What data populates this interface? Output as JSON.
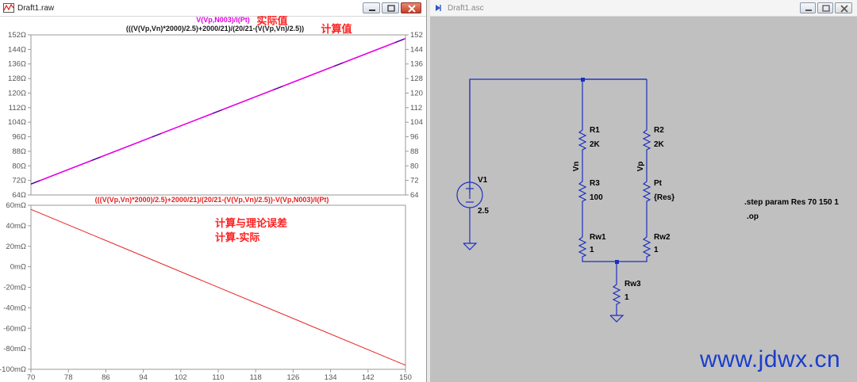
{
  "waveform_window": {
    "title": "Draft1.raw",
    "top_pane": {
      "trace_label_measured": "V(Vp,N003)/I(Pt)",
      "annotation_measured": "实际值",
      "trace_label_calc": "(((V(Vp,Vn)*2000)/2.5)+2000/21)/(20/21-(V(Vp,Vn)/2.5))",
      "annotation_calc": "计算值",
      "y_ticks_left": [
        "152Ω",
        "144Ω",
        "136Ω",
        "128Ω",
        "120Ω",
        "112Ω",
        "104Ω",
        "96Ω",
        "88Ω",
        "80Ω",
        "72Ω",
        "64Ω"
      ],
      "y_ticks_right": [
        "152",
        "144",
        "136",
        "128",
        "120",
        "112",
        "104",
        "96",
        "88",
        "80",
        "72",
        "64"
      ]
    },
    "bottom_pane": {
      "trace_label": "(((V(Vp,Vn)*2000)/2.5)+2000/21)/(20/21-(V(Vp,Vn)/2.5))-V(Vp,N003)/I(Pt)",
      "annotation_line1": "计算与理论误差",
      "annotation_line2": "计算-实际",
      "y_ticks": [
        "60mΩ",
        "40mΩ",
        "20mΩ",
        "0mΩ",
        "-20mΩ",
        "-40mΩ",
        "-60mΩ",
        "-80mΩ",
        "-100mΩ"
      ]
    },
    "x_ticks": [
      "70",
      "78",
      "86",
      "94",
      "102",
      "110",
      "118",
      "126",
      "134",
      "142",
      "150"
    ],
    "colors": {
      "measured": "#e600e6",
      "calc": "#1a1a80",
      "error": "#e62020",
      "annotation": "#ff2020"
    }
  },
  "schematic_window": {
    "title": "Draft1.asc",
    "components": {
      "r1_name": "R1",
      "r1_value": "2K",
      "r2_name": "R2",
      "r2_value": "2K",
      "r3_name": "R3",
      "r3_value": "100",
      "pt_name": "Pt",
      "pt_value": "{Res}",
      "rw1_name": "Rw1",
      "rw1_value": "1",
      "rw2_name": "Rw2",
      "rw2_value": "1",
      "rw3_name": "Rw3",
      "rw3_value": "1",
      "v1_name": "V1",
      "v1_value": "2.5"
    },
    "net_vn": "Vn",
    "net_vp": "Vp",
    "directive_step": ".step param Res 70 150 1",
    "directive_op": ".op",
    "colors": {
      "wire": "#1e2fbf",
      "background": "#c0c0c0"
    }
  },
  "chart_data": [
    {
      "type": "line",
      "title": "",
      "xlim": [
        70,
        150
      ],
      "ylim": [
        64,
        152
      ],
      "y_unit": "Ω",
      "grid": false,
      "series": [
        {
          "name": "V(Vp,N003)/I(Pt)",
          "x": [
            70,
            150
          ],
          "y": [
            70,
            150
          ]
        },
        {
          "name": "(((V(Vp,Vn)*2000)/2.5)+2000/21)/(20/21-(V(Vp,Vn)/2.5))",
          "x": [
            70,
            150
          ],
          "y": [
            70,
            150
          ]
        }
      ]
    },
    {
      "type": "line",
      "title": "",
      "xlim": [
        70,
        150
      ],
      "ylim": [
        -100,
        60
      ],
      "y_unit": "mΩ",
      "grid": false,
      "series": [
        {
          "name": "(((V(Vp,Vn)*2000)/2.5)+2000/21)/(20/21-(V(Vp,Vn)/2.5))-V(Vp,N003)/I(Pt)",
          "x": [
            70,
            150
          ],
          "y": [
            56,
            -96
          ]
        }
      ]
    }
  ],
  "watermark": "www.jdwx.cn"
}
